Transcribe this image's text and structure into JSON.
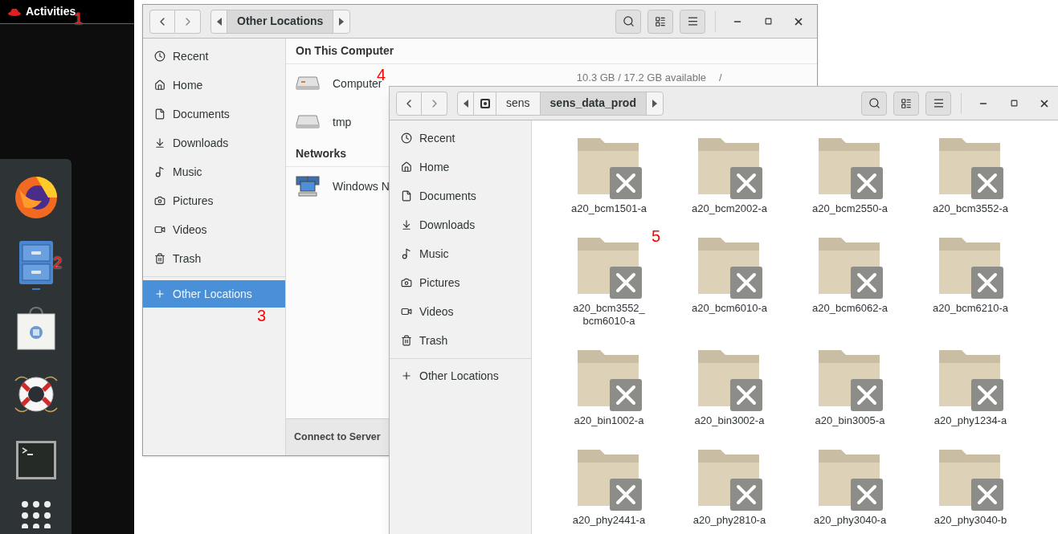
{
  "top_bar": {
    "label": "Activities"
  },
  "dock": {
    "items": [
      {
        "running": false
      },
      {
        "running": true
      },
      {
        "running": false
      },
      {
        "running": false
      },
      {
        "running": false
      }
    ]
  },
  "locations_window": {
    "path": [
      {
        "label": "Other Locations",
        "selected": true
      }
    ],
    "sidebar": {
      "places": [
        {
          "label": "Recent",
          "selected": false
        },
        {
          "label": "Home",
          "selected": false
        },
        {
          "label": "Documents",
          "selected": false
        },
        {
          "label": "Downloads",
          "selected": false
        },
        {
          "label": "Music",
          "selected": false
        },
        {
          "label": "Pictures",
          "selected": false
        },
        {
          "label": "Videos",
          "selected": false
        },
        {
          "label": "Trash",
          "selected": false
        }
      ],
      "other": {
        "label": "Other Locations",
        "selected": true
      }
    },
    "sections": [
      {
        "title": "On This Computer",
        "items": [
          {
            "kind": "system_drive",
            "label": "Computer",
            "detail": "10.3 GB / 17.2 GB available",
            "mount": "/"
          },
          {
            "kind": "drive",
            "label": "tmp"
          }
        ]
      },
      {
        "title": "Networks",
        "items": [
          {
            "kind": "network",
            "label": "Windows N"
          }
        ]
      }
    ],
    "footer": "Connect to Server"
  },
  "folder_window": {
    "path": [
      {
        "kind": "drive",
        "selected": false
      },
      {
        "kind": "folder",
        "label": "sens",
        "selected": false
      },
      {
        "kind": "folder",
        "label": "sens_data_prod",
        "selected": true
      }
    ],
    "sidebar": {
      "places": [
        {
          "label": "Recent",
          "selected": false
        },
        {
          "label": "Home",
          "selected": false
        },
        {
          "label": "Documents",
          "selected": false
        },
        {
          "label": "Downloads",
          "selected": false
        },
        {
          "label": "Music",
          "selected": false
        },
        {
          "label": "Pictures",
          "selected": false
        },
        {
          "label": "Videos",
          "selected": false
        },
        {
          "label": "Trash",
          "selected": false
        }
      ],
      "other": {
        "label": "Other Locations",
        "selected": false
      }
    },
    "files": [
      {
        "name": "a20_bcm1501-a"
      },
      {
        "name": "a20_bcm2002-a"
      },
      {
        "name": "a20_bcm2550-a"
      },
      {
        "name": "a20_bcm3552-a"
      },
      {
        "name": "a20_bcm3552_bcm6010-a"
      },
      {
        "name": "a20_bcm6010-a"
      },
      {
        "name": "a20_bcm6062-a"
      },
      {
        "name": "a20_bcm6210-a"
      },
      {
        "name": "a20_bin1002-a"
      },
      {
        "name": "a20_bin3002-a"
      },
      {
        "name": "a20_bin3005-a"
      },
      {
        "name": "a20_phy1234-a"
      },
      {
        "name": "a20_phy2441-a"
      },
      {
        "name": "a20_phy2810-a"
      },
      {
        "name": "a20_phy3040-a"
      },
      {
        "name": "a20_phy3040-b"
      }
    ]
  },
  "annotations": [
    {
      "text": "1"
    },
    {
      "text": "2"
    },
    {
      "text": "3"
    },
    {
      "text": "4"
    },
    {
      "text": "5"
    }
  ]
}
